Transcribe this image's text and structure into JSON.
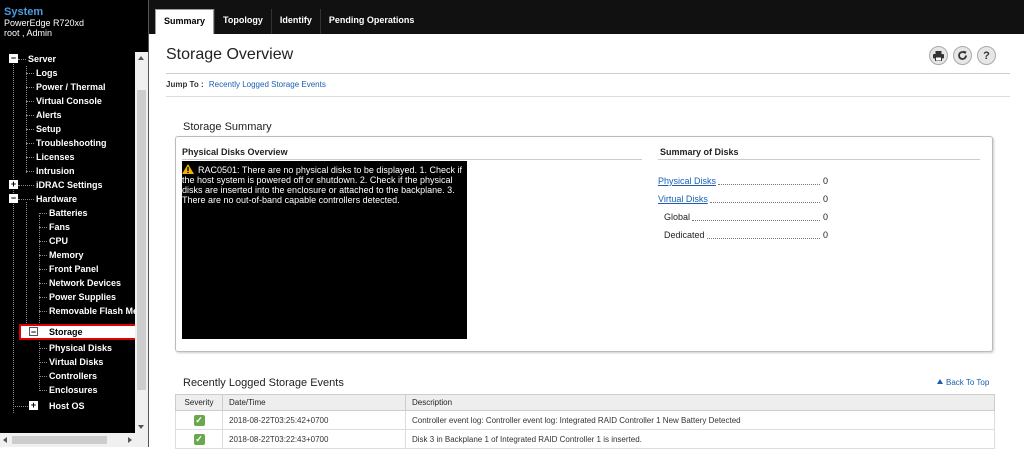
{
  "sidebar": {
    "title": "System",
    "model": "PowerEdge R720xd",
    "user": "root , Admin",
    "tree": [
      {
        "label": "Server",
        "expander": "−"
      },
      {
        "label": "Logs"
      },
      {
        "label": "Power / Thermal"
      },
      {
        "label": "Virtual Console"
      },
      {
        "label": "Alerts"
      },
      {
        "label": "Setup"
      },
      {
        "label": "Troubleshooting"
      },
      {
        "label": "Licenses"
      },
      {
        "label": "Intrusion"
      },
      {
        "label": "iDRAC Settings",
        "expander": "+"
      },
      {
        "label": "Hardware",
        "expander": "−"
      },
      {
        "label": "Batteries"
      },
      {
        "label": "Fans"
      },
      {
        "label": "CPU"
      },
      {
        "label": "Memory"
      },
      {
        "label": "Front Panel"
      },
      {
        "label": "Network Devices"
      },
      {
        "label": "Power Supplies"
      },
      {
        "label": "Removable Flash Me"
      },
      {
        "label": "Storage",
        "expander": "−",
        "selected": true
      },
      {
        "label": "Physical Disks"
      },
      {
        "label": "Virtual Disks"
      },
      {
        "label": "Controllers"
      },
      {
        "label": "Enclosures"
      },
      {
        "label": "Host OS",
        "expander": "+"
      }
    ]
  },
  "tabs": [
    "Summary",
    "Topology",
    "Identify",
    "Pending Operations"
  ],
  "page": {
    "title": "Storage Overview",
    "jump_label": "Jump To :",
    "jump_link": "Recently Logged Storage Events",
    "tools": {
      "print": "print-icon",
      "refresh": "refresh-icon",
      "help": "help-icon"
    }
  },
  "summary": {
    "title": "Storage Summary",
    "physical_overview_title": "Physical Disks Overview",
    "message": "RAC0501: There are no physical disks to be displayed. 1. Check if the host system is powered off or shutdown. 2. Check if the physical disks are inserted into the enclosure or attached to the backplane. 3. There are no out-of-band capable controllers detected.",
    "disks_title": "Summary of Disks",
    "disks": [
      {
        "label": "Physical Disks",
        "value": "0",
        "link": true
      },
      {
        "label": "Virtual Disks",
        "value": "0",
        "link": true
      },
      {
        "label": "Global",
        "value": "0",
        "link": false
      },
      {
        "label": "Dedicated",
        "value": "0",
        "link": false
      }
    ]
  },
  "events": {
    "title": "Recently Logged Storage Events",
    "back_to_top": "Back To Top",
    "columns": [
      "Severity",
      "Date/Time",
      "Description"
    ],
    "rows": [
      {
        "severity": "ok",
        "datetime": "2018-08-22T03:25:42+0700",
        "description": "Controller event log: Controller event log: Integrated RAID Controller 1 New Battery Detected"
      },
      {
        "severity": "ok",
        "datetime": "2018-08-22T03:22:43+0700",
        "description": "Disk 3 in Backplane 1 of Integrated RAID Controller 1 is inserted."
      }
    ]
  },
  "colors": {
    "accent": "#4a9de0",
    "link": "#1a5fb4",
    "selection_border": "#e00000",
    "ok": "#6aa84f",
    "warning": "#f0b400"
  }
}
